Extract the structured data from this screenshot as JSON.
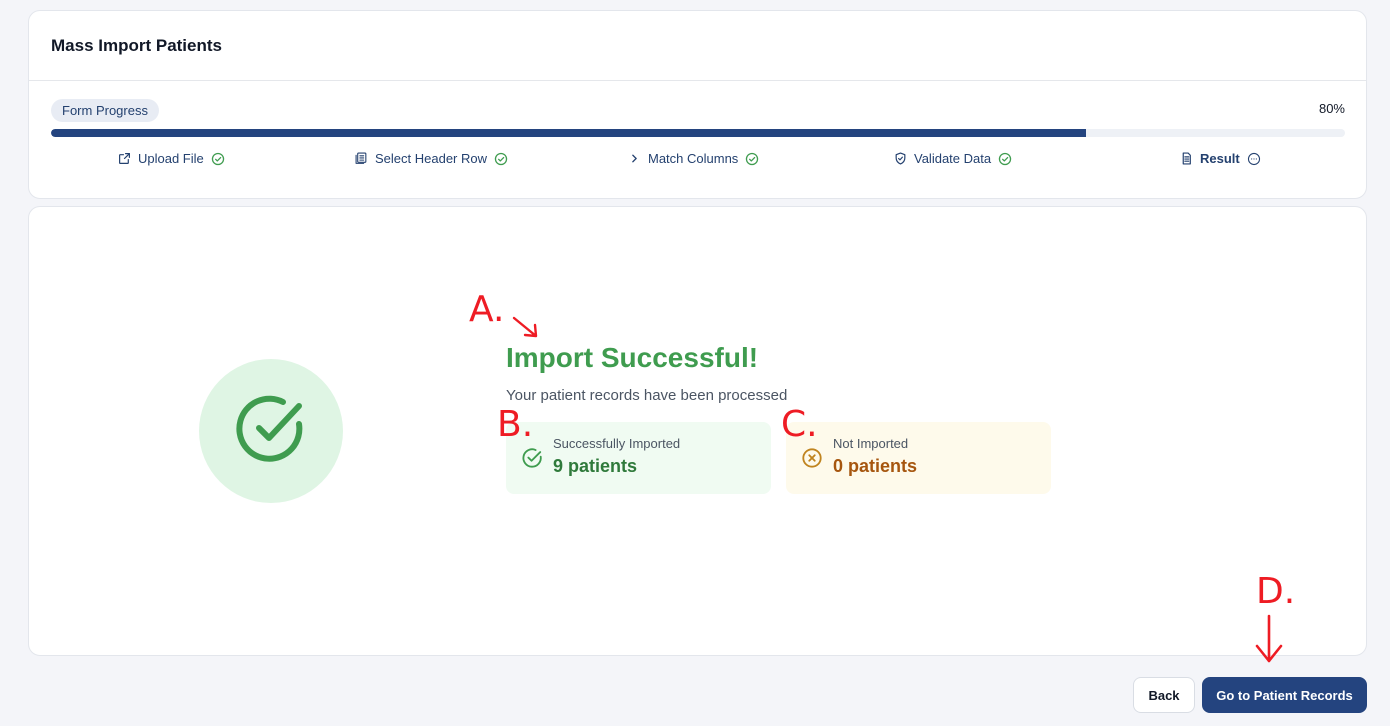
{
  "header": {
    "title": "Mass Import Patients",
    "progress_label": "Form Progress",
    "progress_percent_text": "80%",
    "progress_fraction": 0.8
  },
  "steps": [
    {
      "label": "Upload File",
      "icon": "external-link-icon",
      "status_icon": "check-circle-icon",
      "active": false
    },
    {
      "label": "Select Header Row",
      "icon": "table-icon",
      "status_icon": "check-circle-icon",
      "active": false
    },
    {
      "label": "Match Columns",
      "icon": "chevron-right-icon",
      "status_icon": "check-circle-icon",
      "active": false
    },
    {
      "label": "Validate Data",
      "icon": "shield-check-icon",
      "status_icon": "check-circle-icon",
      "active": false
    },
    {
      "label": "Result",
      "icon": "document-icon",
      "status_icon": "more-circle-icon",
      "active": true
    }
  ],
  "result": {
    "title": "Import Successful!",
    "subtitle": "Your patient records have been processed",
    "success": {
      "label": "Successfully Imported",
      "value": "9 patients"
    },
    "failed": {
      "label": "Not Imported",
      "value": "0 patients"
    }
  },
  "annotations": {
    "a": "A.",
    "b": "B.",
    "c": "C.",
    "d": "D."
  },
  "footer": {
    "back_label": "Back",
    "primary_label": "Go to Patient Records"
  },
  "colors": {
    "brand": "#24447f",
    "success": "#3f9c4f",
    "success_bg": "#dff5e4",
    "warning": "#a6560f",
    "warning_bg": "#fefaeb",
    "annotation": "#ee1c24"
  }
}
